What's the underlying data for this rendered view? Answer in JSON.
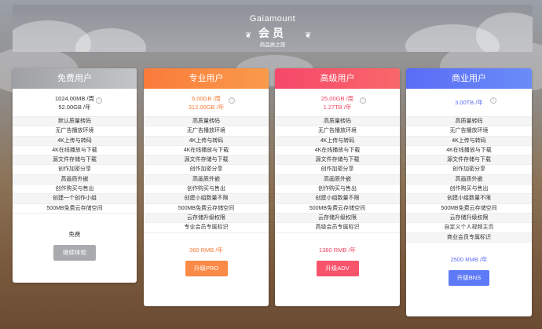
{
  "header": {
    "brand": "Gaiamount",
    "title": "会员",
    "subtitle": "商品质之旅"
  },
  "plans": [
    {
      "name": "免费用户",
      "quota_week": "1024.00MB /周",
      "quota_year": "52.00GB /年",
      "features": [
        "默认质量转码",
        "无广告播放环境",
        "4K上传与转码",
        "4K在线播放与下载",
        "源文件存储与下载",
        "创作加密分享",
        "高画质外嵌",
        "创作购买与售出",
        "创建一个创作小组",
        "500MB免费云存储空间"
      ],
      "price": "免费",
      "button": "继续体验",
      "color": "#a6a8ab"
    },
    {
      "name": "专业用户",
      "quota_week": "6.00GB /周",
      "quota_year": "312.00GB /年",
      "features": [
        "高质量转码",
        "无广告播放环境",
        "4K上传与转码",
        "4K在线播放与下载",
        "源文件存储与下载",
        "创作加密分享",
        "高画质外嵌",
        "创作购买与售出",
        "创建小组数量不限",
        "500MB免费云存储空间",
        "云存储升级权限",
        "专业会员专属标识"
      ],
      "price": "360 RMB /年",
      "button": "升级PRO",
      "color": "#f9853e"
    },
    {
      "name": "高级用户",
      "quota_week": "25.00GB /周",
      "quota_year": "1.27TB /年",
      "features": [
        "高质量转码",
        "无广告播放环境",
        "4K上传与转码",
        "4K在线播放与下载",
        "源文件存储与下载",
        "创作加密分享",
        "高画质外嵌",
        "创作购买与售出",
        "创建小组数量不限",
        "500MB免费云存储空间",
        "云存储升级权限",
        "高级会员专属标识"
      ],
      "price": "1380 RMB /年",
      "button": "升级ADV",
      "color": "#f7546a"
    },
    {
      "name": "商业用户",
      "quota_week": "3.00TB /年",
      "quota_year": "",
      "features": [
        "高质量转码",
        "无广告播放环境",
        "4K上传与转码",
        "4K在线播放与下载",
        "源文件存储与下载",
        "创作加密分享",
        "高画质外嵌",
        "创作购买与售出",
        "创建小组数量不限",
        "500MB免费云存储空间",
        "云存储升级权限",
        "自定义个人视频主页",
        "商业会员专属标识"
      ],
      "price": "2500 RMB /年",
      "button": "升级BNS",
      "color": "#5d73f5"
    }
  ]
}
